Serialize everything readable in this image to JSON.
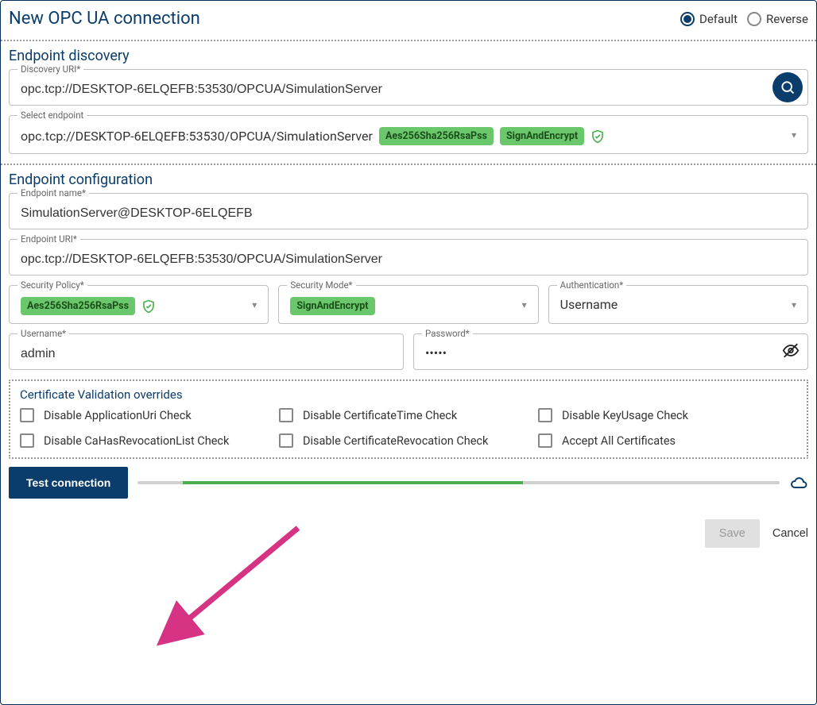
{
  "header": {
    "title": "New OPC UA connection",
    "radio_default": "Default",
    "radio_reverse": "Reverse",
    "selected": "default"
  },
  "discovery": {
    "section_title": "Endpoint discovery",
    "uri_label": "Discovery URI*",
    "uri_value": "opc.tcp://DESKTOP-6ELQEFB:53530/OPCUA/SimulationServer",
    "select_label": "Select endpoint",
    "select_value": "opc.tcp://DESKTOP-6ELQEFB:53530/OPCUA/SimulationServer",
    "chip_policy": "Aes256Sha256RsaPss",
    "chip_mode": "SignAndEncrypt"
  },
  "config": {
    "section_title": "Endpoint configuration",
    "name_label": "Endpoint name*",
    "name_value": "SimulationServer@DESKTOP-6ELQEFB",
    "uri_label": "Endpoint URI*",
    "uri_value": "opc.tcp://DESKTOP-6ELQEFB:53530/OPCUA/SimulationServer",
    "policy_label": "Security Policy*",
    "policy_value": "Aes256Sha256RsaPss",
    "mode_label": "Security Mode*",
    "mode_value": "SignAndEncrypt",
    "auth_label": "Authentication*",
    "auth_value": "Username",
    "username_label": "Username*",
    "username_value": "admin",
    "password_label": "Password*",
    "password_value": "•••••"
  },
  "cert": {
    "title": "Certificate Validation overrides",
    "c1": "Disable ApplicationUri Check",
    "c2": "Disable CaHasRevocationList Check",
    "c3": "Disable CertificateTime Check",
    "c4": "Disable CertificateRevocation Check",
    "c5": "Disable KeyUsage Check",
    "c6": "Accept All Certificates"
  },
  "actions": {
    "test": "Test connection",
    "save": "Save",
    "cancel": "Cancel"
  },
  "progress": {
    "left_pct": 7,
    "width_pct": 53
  }
}
